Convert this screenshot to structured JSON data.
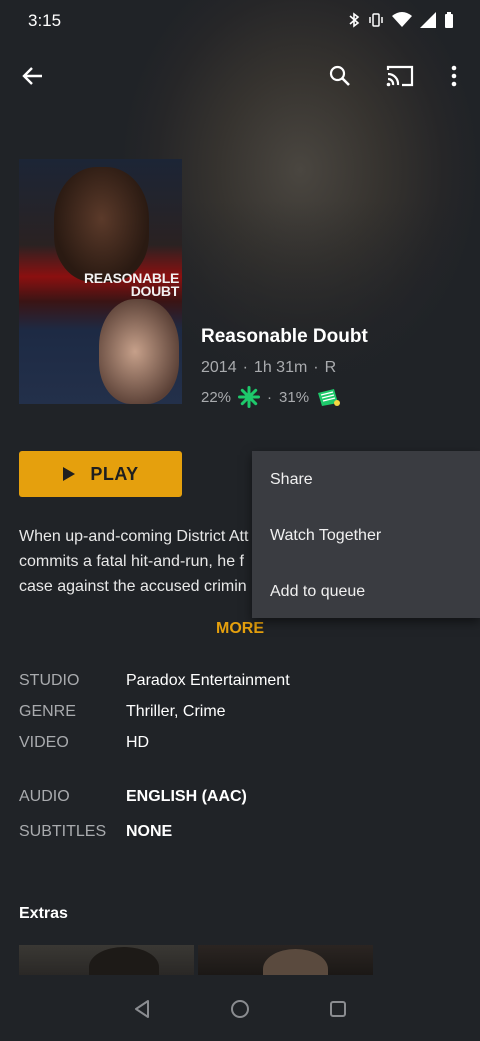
{
  "status_bar": {
    "time": "3:15"
  },
  "movie": {
    "poster_title": "REASONABLE DOUBT",
    "poster_title_line1": "REASONABLE",
    "poster_title_line2": "DOUBT",
    "title": "Reasonable Doubt",
    "year": "2014",
    "duration": "1h 31m",
    "rating": "R",
    "sep": "·",
    "critic_score": "22%",
    "audience_score": "31%"
  },
  "play_label": "PLAY",
  "summary_lines": [
    "When up-and-coming District Att",
    "commits a fatal hit-and-run, he f",
    "case against the accused crimin"
  ],
  "more_label": "MORE",
  "details": {
    "studio_label": "STUDIO",
    "studio_value": "Paradox Entertainment",
    "genre_label": "GENRE",
    "genre_value": "Thriller, Crime",
    "video_label": "VIDEO",
    "video_value": "HD",
    "audio_label": "AUDIO",
    "audio_value": "ENGLISH (AAC)",
    "subtitles_label": "SUBTITLES",
    "subtitles_value": "NONE"
  },
  "extras_title": "Extras",
  "context_menu": [
    "Share",
    "Watch Together",
    "Add to queue"
  ],
  "colors": {
    "accent": "#e5a00d",
    "background": "#202327",
    "menu": "#3a3c41"
  }
}
